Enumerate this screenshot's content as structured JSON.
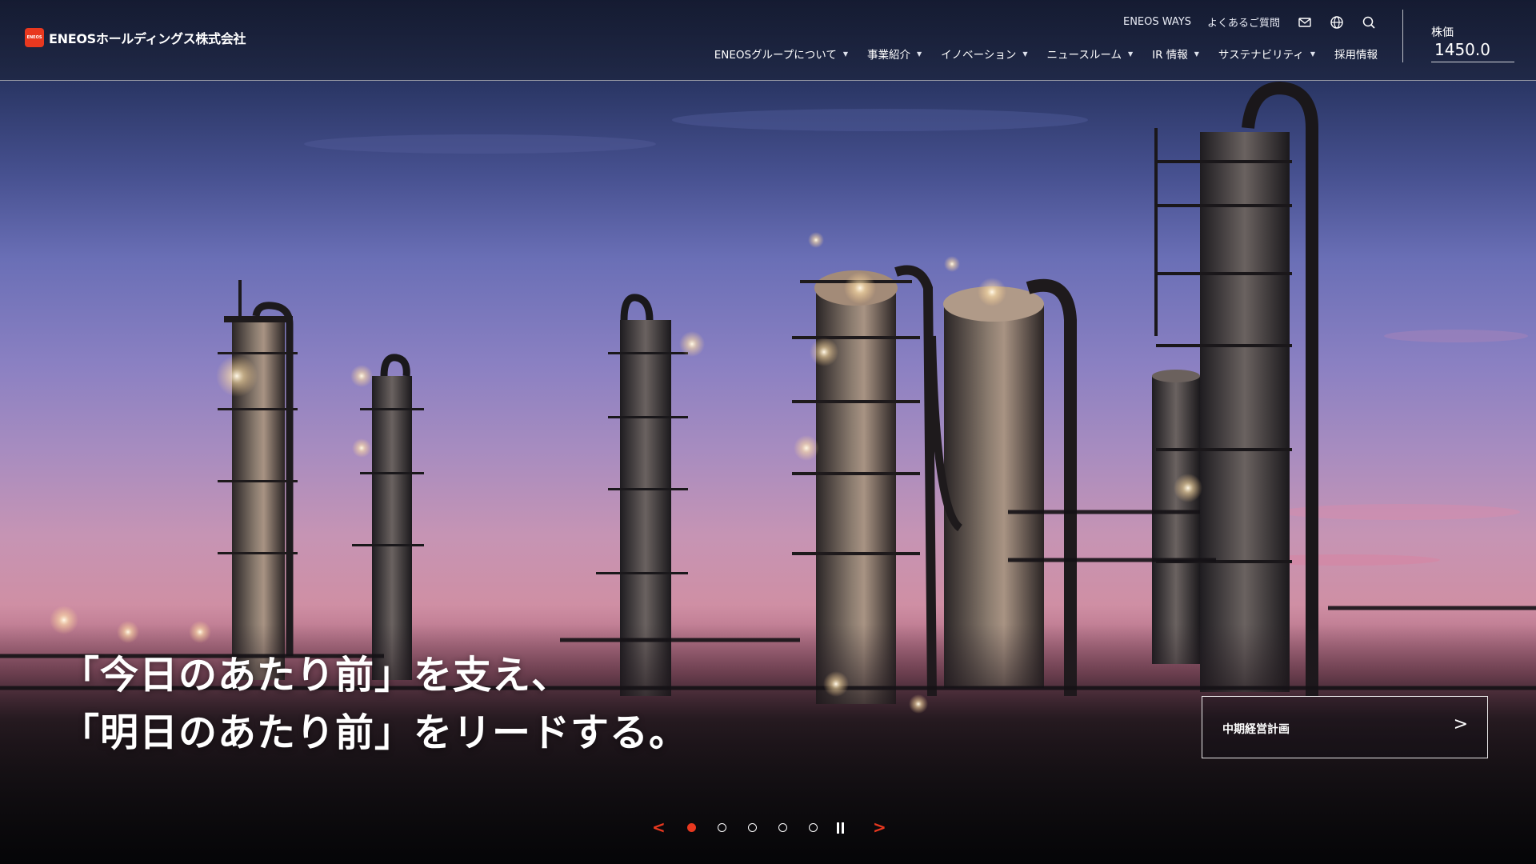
{
  "brand": {
    "logo_mark": "ENEOS",
    "name": "ENEOSホールディングス株式会社",
    "accent_color": "#e8381f"
  },
  "utility": {
    "links": [
      "ENEOS WAYS",
      "よくあるご質問"
    ],
    "icons": [
      "mail-icon",
      "globe-icon",
      "search-icon"
    ]
  },
  "nav": {
    "items": [
      {
        "label": "ENEOSグループについて",
        "has_caret": true
      },
      {
        "label": "事業紹介",
        "has_caret": true
      },
      {
        "label": "イノベーション",
        "has_caret": true
      },
      {
        "label": "ニュースルーム",
        "has_caret": true
      },
      {
        "label": "IR 情報",
        "has_caret": true
      },
      {
        "label": "サステナビリティ",
        "has_caret": true
      },
      {
        "label": "採用情報",
        "has_caret": false
      }
    ],
    "caret": "▼"
  },
  "stock": {
    "label": "株価",
    "value": "1450.0"
  },
  "hero": {
    "line1": "「今日のあたり前」を支え、",
    "line2": "「明日のあたり前」をリードする。",
    "cta_label": "中期経営計画",
    "cta_arrow": ">"
  },
  "carousel": {
    "prev": "<",
    "next": ">",
    "slide_count": 5,
    "active_index": 0
  }
}
